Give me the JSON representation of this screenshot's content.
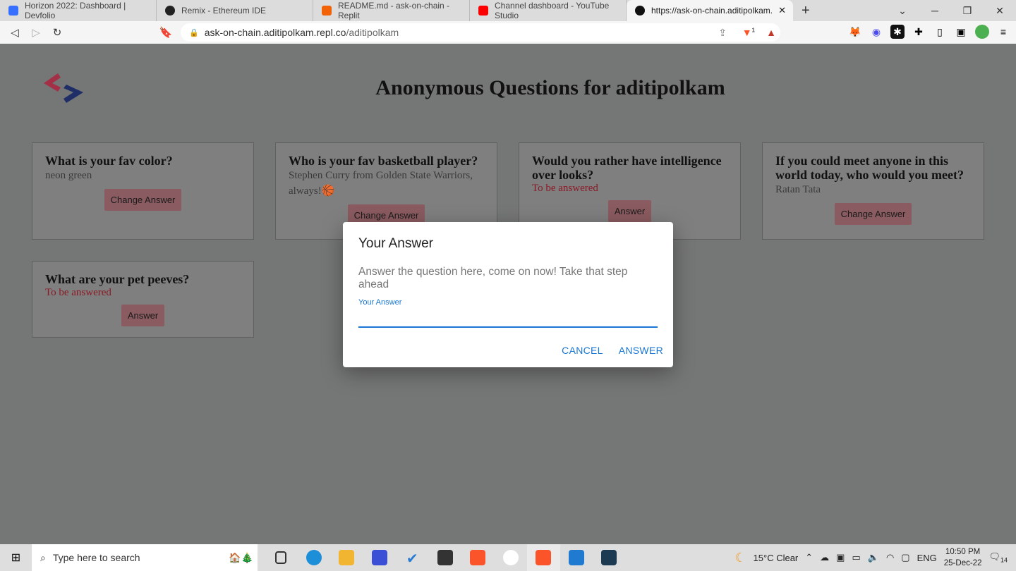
{
  "browser": {
    "tabs": [
      {
        "title": "Horizon 2022: Dashboard | Devfolio",
        "icon": "devfolio-icon",
        "color": "#3770ff"
      },
      {
        "title": "Remix - Ethereum IDE",
        "icon": "remix-icon",
        "color": "#222222"
      },
      {
        "title": "README.md - ask-on-chain - Replit",
        "icon": "replit-icon",
        "color": "#f26207"
      },
      {
        "title": "Channel dashboard - YouTube Studio",
        "icon": "youtube-icon",
        "color": "#ff0000"
      },
      {
        "title": "https://ask-on-chain.aditipolkam.",
        "icon": "site-icon",
        "color": "#111111",
        "active": true
      }
    ],
    "url_host": "ask-on-chain.aditipolkam.repl.co",
    "url_path": "/aditipolkam",
    "brave_badge": "1"
  },
  "page": {
    "title": "Anonymous Questions for aditipolkam",
    "cards": [
      {
        "question": "What is your fav color?",
        "answer": "neon green",
        "button": "Change Answer"
      },
      {
        "question": "Who is your fav basketball player?",
        "answer": "Stephen Curry from Golden State Warriors, always!",
        "emoji": "🏀",
        "button": "Change Answer"
      },
      {
        "question": "Would you rather have intelligence over looks?",
        "status": "To be answered",
        "button": "Answer"
      },
      {
        "question": "If you could meet anyone in this world today, who would you meet?",
        "answer": "Ratan Tata",
        "button": "Change Answer"
      },
      {
        "question": "What are your pet peeves?",
        "status": "To be answered",
        "button": "Answer"
      }
    ]
  },
  "dialog": {
    "title": "Your Answer",
    "description": "Answer the question here, come on now! Take that step ahead",
    "field_label": "Your Answer",
    "field_value": "",
    "cancel": "CANCEL",
    "submit": "ANSWER"
  },
  "taskbar": {
    "search_placeholder": "Type here to search",
    "weather": "15°C  Clear",
    "language": "ENG",
    "time": "10:50 PM",
    "date": "25-Dec-22",
    "notifications": "14"
  },
  "colors": {
    "accent": "#1976d2",
    "pending": "#8a1a26",
    "button": "#8a5b60"
  }
}
